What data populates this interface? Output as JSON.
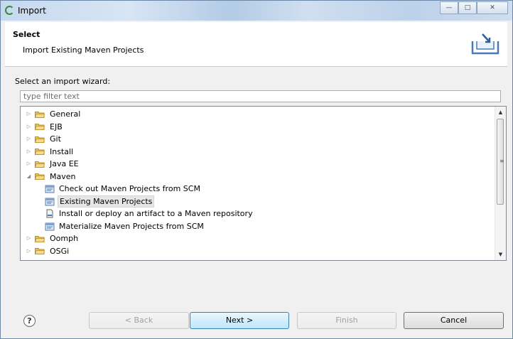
{
  "window": {
    "title": "Import"
  },
  "header": {
    "title": "Select",
    "subtitle": "Import Existing Maven Projects"
  },
  "wizard": {
    "label": "Select an import wizard:",
    "filter_placeholder": "type filter text",
    "tree": [
      {
        "label": "General",
        "kind": "folder",
        "expanded": false,
        "level": 0
      },
      {
        "label": "EJB",
        "kind": "folder",
        "expanded": false,
        "level": 0
      },
      {
        "label": "Git",
        "kind": "folder",
        "expanded": false,
        "level": 0
      },
      {
        "label": "Install",
        "kind": "folder",
        "expanded": false,
        "level": 0
      },
      {
        "label": "Java EE",
        "kind": "folder",
        "expanded": false,
        "level": 0
      },
      {
        "label": "Maven",
        "kind": "folder",
        "expanded": true,
        "level": 0
      },
      {
        "label": "Check out Maven Projects from SCM",
        "kind": "wizard",
        "level": 1
      },
      {
        "label": "Existing Maven Projects",
        "kind": "wizard",
        "level": 1,
        "selected": true
      },
      {
        "label": "Install or deploy an artifact to a Maven repository",
        "kind": "wizard-file",
        "level": 1
      },
      {
        "label": "Materialize Maven Projects from SCM",
        "kind": "wizard",
        "level": 1
      },
      {
        "label": "Oomph",
        "kind": "folder",
        "expanded": false,
        "level": 0
      },
      {
        "label": "OSGi",
        "kind": "folder",
        "expanded": false,
        "level": 0
      }
    ]
  },
  "buttons": {
    "help": "?",
    "back": "< Back",
    "next": "Next >",
    "finish": "Finish",
    "cancel": "Cancel"
  },
  "colors": {
    "folder": "#e8c15a",
    "folder_edge": "#b8902a",
    "default_button": "#bee6fd"
  }
}
